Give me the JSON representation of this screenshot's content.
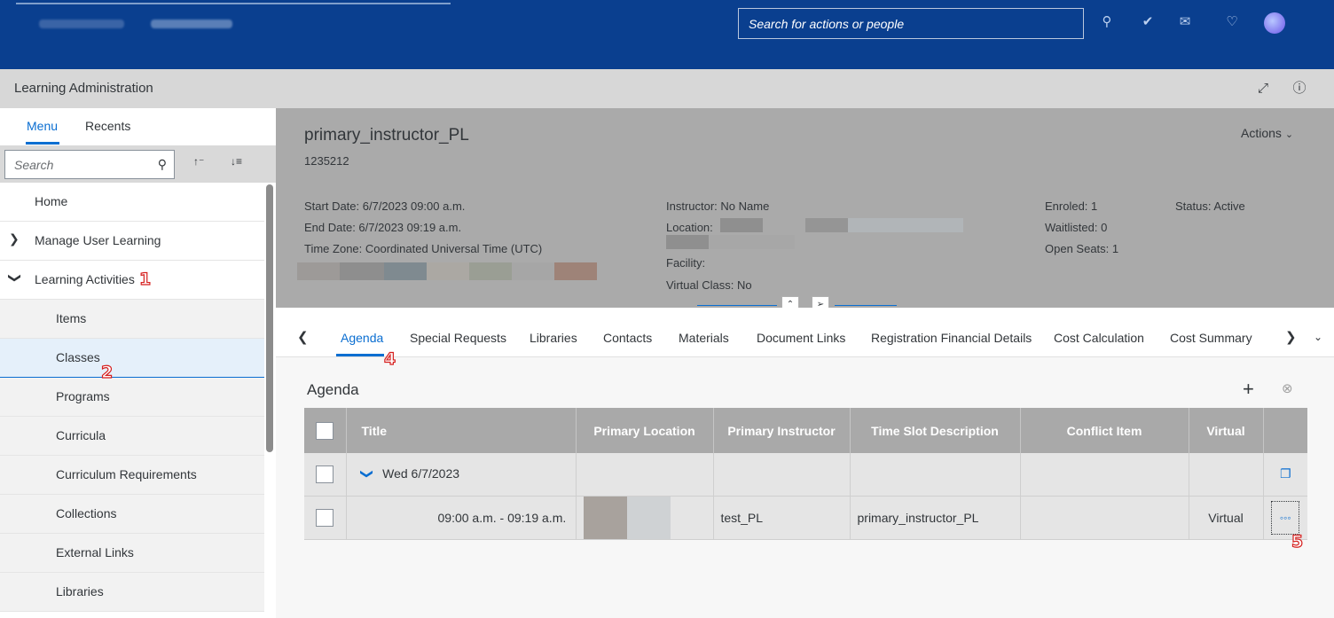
{
  "shell": {
    "search_placeholder": "Search for actions or people",
    "icons": [
      "search-icon",
      "check-circle-icon",
      "chat-icon",
      "bell-icon",
      "avatar"
    ]
  },
  "app": {
    "title": "Learning Administration",
    "icons": [
      "fullscreen-icon",
      "help-icon"
    ]
  },
  "leftnav": {
    "tabs": [
      {
        "label": "Menu",
        "active": true
      },
      {
        "label": "Recents",
        "active": false
      }
    ],
    "search_placeholder": "Search",
    "items": [
      {
        "label": "Home"
      },
      {
        "label": "Manage User Learning"
      },
      {
        "label": "Learning Activities"
      },
      {
        "label": "Items"
      },
      {
        "label": "Classes"
      },
      {
        "label": "Programs"
      },
      {
        "label": "Curricula"
      },
      {
        "label": "Curriculum Requirements"
      },
      {
        "label": "Collections"
      },
      {
        "label": "External Links"
      },
      {
        "label": "Libraries"
      }
    ]
  },
  "badges": [
    "1",
    "2",
    "4",
    "5"
  ],
  "object": {
    "title": "primary_instructor_PL",
    "id": "1235212",
    "actions_label": "Actions",
    "start_date": "Start Date: 6/7/2023 09:00 a.m.",
    "end_date": "End Date: 6/7/2023 09:19 a.m.",
    "time_zone": "Time Zone: Coordinated Universal Time (UTC)",
    "instructor": "Instructor: No Name",
    "location": "Location:",
    "facility": "Facility:",
    "virtual_class": "Virtual Class: No",
    "enroled": "Enroled: 1",
    "waitlisted": "Waitlisted: 0",
    "open_seats": "Open Seats: 1",
    "status": "Status: Active"
  },
  "section_tabs": [
    {
      "label": "Agenda",
      "active": true
    },
    {
      "label": "Special Requests"
    },
    {
      "label": "Libraries"
    },
    {
      "label": "Contacts"
    },
    {
      "label": "Materials"
    },
    {
      "label": "Document Links"
    },
    {
      "label": "Registration Financial Details"
    },
    {
      "label": "Cost Calculation"
    },
    {
      "label": "Cost Summary"
    }
  ],
  "agenda": {
    "title": "Agenda",
    "columns": [
      "Title",
      "Primary Location",
      "Primary Instructor",
      "Time Slot Description",
      "Conflict Item",
      "Virtual"
    ],
    "group_label": "Wed 6/7/2023",
    "rows": [
      {
        "title": "09:00 a.m. - 09:19 a.m.",
        "primary_location": "",
        "primary_instructor": "test_PL",
        "time_slot_description": "primary_instructor_PL",
        "conflict_item": "",
        "virtual": "Virtual"
      }
    ]
  }
}
